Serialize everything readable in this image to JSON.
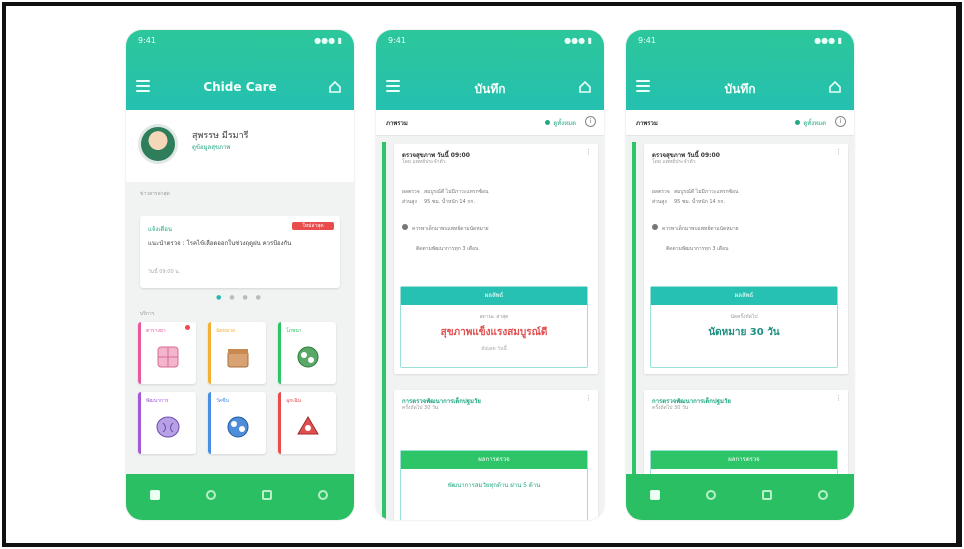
{
  "phones": [
    {
      "header": {
        "time": "9:41",
        "signal": "●●● ▮",
        "title": "Chide Care"
      },
      "profile": {
        "name": "สุพรรษ มีรมารี",
        "subtitle": "ดูข้อมูลสุขภาพ"
      },
      "section_notice": "ข่าวสารล่าสุด",
      "notice": {
        "title": "แจ้งเตือน",
        "badge": "ใหม่ล่าสุด",
        "body": "แนะนำตรวจ : โรคไข้เลือดออกในช่วงฤดูฝน ควรป้องกัน",
        "date": "วันนี้ 09:00 น."
      },
      "dots": "● ● ● ●",
      "section_services": "บริการ",
      "tiles": [
        {
          "label": "ตารางยา",
          "color": "#e85aa0",
          "art_color": "#f3b5cc",
          "new": true
        },
        {
          "label": "นัดหมาย",
          "color": "#f2b134",
          "art_color": "#d9a272",
          "new": false
        },
        {
          "label": "โภชนา",
          "color": "#2ec468",
          "art_color": "#5aa868",
          "new": false
        },
        {
          "label": "พัฒนาการ",
          "color": "#a35ad9",
          "art_color": "#b7a1e6",
          "new": false
        },
        {
          "label": "วัคซีน",
          "color": "#4a8fe3",
          "art_color": "#4f8ed8",
          "new": false
        },
        {
          "label": "ฉุกเฉิน",
          "color": "#e94c4c",
          "art_color": "#e05050",
          "new": false
        }
      ]
    },
    {
      "header": {
        "time": "9:41",
        "signal": "●●● ▮",
        "title": "บันทึก"
      },
      "subbar": {
        "left": "ภาพรวม",
        "right": "ดูทั้งหมด",
        "info": "i"
      },
      "card1": {
        "title": "ตรวจสุขภาพ วันนี้ 09:00",
        "sub": "โดย แพทย์ประจำตัว",
        "more": "⋮",
        "rows": [
          {
            "k": "ผลตรวจ",
            "v": "สมบูรณ์ดี ไม่มีภาวะแทรกซ้อน"
          },
          {
            "k": "ส่วนสูง",
            "v": "95 ซม. น้ำหนัก 14 กก."
          }
        ],
        "warn1": "ควรพาเด็กมาพบแพทย์ตามนัดหมาย",
        "warn2": "ติดตามพัฒนาการทุก 3 เดือน"
      },
      "result1": {
        "header": "ผลลัพธ์",
        "small": "สถานะ ล่าสุด",
        "value": "สุขภาพแข็งแรงสมบูรณ์ดี",
        "value_color": "#e05050",
        "footer": "อัปเดต วันนี้"
      },
      "card2": {
        "title": "การตรวจพัฒนาการเด็กปฐมวัย",
        "sub": "ครั้งถัดไป 30 วัน",
        "more": "⋮"
      },
      "result2": {
        "header": "ผลการตรวจ",
        "value": "พัฒนาการสมวัยทุกด้าน ผ่าน 5 ด้าน"
      }
    },
    {
      "header": {
        "time": "9:41",
        "signal": "●●● ▮",
        "title": "บันทึก"
      },
      "subbar": {
        "left": "ภาพรวม",
        "right": "ดูทั้งหมด",
        "info": "i"
      },
      "card1": {
        "title": "ตรวจสุขภาพ วันนี้ 09:00",
        "sub": "โดย แพทย์ประจำตัว",
        "more": "⋮",
        "rows": [
          {
            "k": "ผลตรวจ",
            "v": "สมบูรณ์ดี ไม่มีภาวะแทรกซ้อน"
          },
          {
            "k": "ส่วนสูง",
            "v": "95 ซม. น้ำหนัก 14 กก."
          }
        ],
        "warn1": "ควรพาเด็กมาพบแพทย์ตามนัดหมาย",
        "warn2": "ติดตามพัฒนาการทุก 3 เดือน"
      },
      "result1": {
        "header": "ผลลัพธ์",
        "small": "นัดครั้งถัดไป",
        "value": "นัดหมาย 30 วัน",
        "value_color": "#1e8f80",
        "footer": ""
      },
      "card2": {
        "title": "การตรวจพัฒนาการเด็กปฐมวัย",
        "sub": "ครั้งถัดไป 30 วัน",
        "more": "⋮"
      },
      "result2": {
        "header": "ผลการตรวจ",
        "value": ""
      }
    }
  ]
}
